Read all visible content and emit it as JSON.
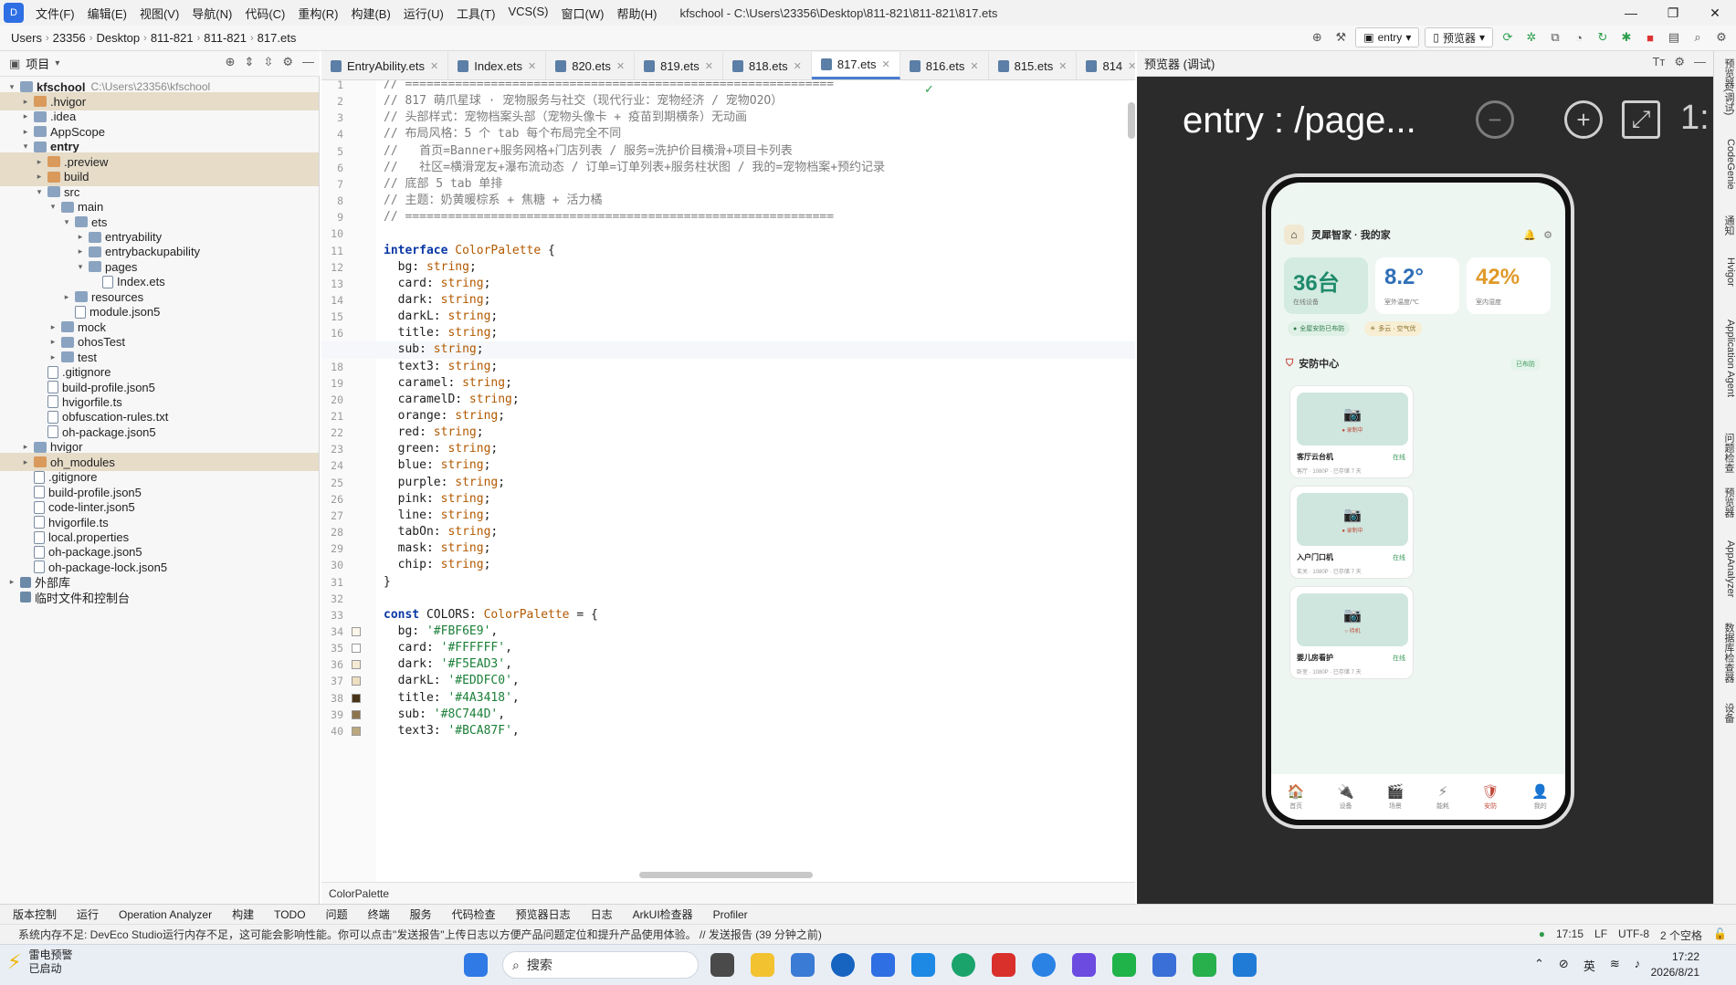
{
  "menubar": {
    "items": [
      "文件(F)",
      "编辑(E)",
      "视图(V)",
      "导航(N)",
      "代码(C)",
      "重构(R)",
      "构建(B)",
      "运行(U)",
      "工具(T)",
      "VCS(S)",
      "窗口(W)",
      "帮助(H)"
    ],
    "title": "kfschool - C:\\Users\\23356\\Desktop\\811-821\\811-821\\817.ets"
  },
  "navbar": {
    "crumbs": [
      "Users",
      "23356",
      "Desktop",
      "811-821",
      "811-821",
      "817.ets"
    ],
    "run_config": "entry",
    "device": "预览器"
  },
  "project": {
    "header": "项目",
    "tree": [
      {
        "label": "kfschool",
        "dim": "C:\\Users\\23356\\kfschool",
        "depth": 0,
        "arrow": "▾",
        "kind": "folder",
        "bold": true
      },
      {
        "label": ".hvigor",
        "depth": 1,
        "arrow": "▸",
        "kind": "ofolder",
        "sel": true
      },
      {
        "label": ".idea",
        "depth": 1,
        "arrow": "▸",
        "kind": "folder"
      },
      {
        "label": "AppScope",
        "depth": 1,
        "arrow": "▸",
        "kind": "folder"
      },
      {
        "label": "entry",
        "depth": 1,
        "arrow": "▾",
        "kind": "folder",
        "bold": true
      },
      {
        "label": ".preview",
        "depth": 2,
        "arrow": "▸",
        "kind": "ofolder",
        "sel": true
      },
      {
        "label": "build",
        "depth": 2,
        "arrow": "▸",
        "kind": "ofolder",
        "sel": true
      },
      {
        "label": "src",
        "depth": 2,
        "arrow": "▾",
        "kind": "folder"
      },
      {
        "label": "main",
        "depth": 3,
        "arrow": "▾",
        "kind": "folder"
      },
      {
        "label": "ets",
        "depth": 4,
        "arrow": "▾",
        "kind": "folder"
      },
      {
        "label": "entryability",
        "depth": 5,
        "arrow": "▸",
        "kind": "folder"
      },
      {
        "label": "entrybackupability",
        "depth": 5,
        "arrow": "▸",
        "kind": "folder"
      },
      {
        "label": "pages",
        "depth": 5,
        "arrow": "▾",
        "kind": "folder"
      },
      {
        "label": "Index.ets",
        "depth": 6,
        "arrow": "",
        "kind": "file"
      },
      {
        "label": "resources",
        "depth": 4,
        "arrow": "▸",
        "kind": "folder"
      },
      {
        "label": "module.json5",
        "depth": 4,
        "arrow": "",
        "kind": "file"
      },
      {
        "label": "mock",
        "depth": 3,
        "arrow": "▸",
        "kind": "folder"
      },
      {
        "label": "ohosTest",
        "depth": 3,
        "arrow": "▸",
        "kind": "folder"
      },
      {
        "label": "test",
        "depth": 3,
        "arrow": "▸",
        "kind": "folder"
      },
      {
        "label": ".gitignore",
        "depth": 2,
        "arrow": "",
        "kind": "file"
      },
      {
        "label": "build-profile.json5",
        "depth": 2,
        "arrow": "",
        "kind": "file"
      },
      {
        "label": "hvigorfile.ts",
        "depth": 2,
        "arrow": "",
        "kind": "file"
      },
      {
        "label": "obfuscation-rules.txt",
        "depth": 2,
        "arrow": "",
        "kind": "file"
      },
      {
        "label": "oh-package.json5",
        "depth": 2,
        "arrow": "",
        "kind": "file"
      },
      {
        "label": "hvigor",
        "depth": 1,
        "arrow": "▸",
        "kind": "folder"
      },
      {
        "label": "oh_modules",
        "depth": 1,
        "arrow": "▸",
        "kind": "ofolder",
        "sel": true
      },
      {
        "label": ".gitignore",
        "depth": 1,
        "arrow": "",
        "kind": "file"
      },
      {
        "label": "build-profile.json5",
        "depth": 1,
        "arrow": "",
        "kind": "file"
      },
      {
        "label": "code-linter.json5",
        "depth": 1,
        "arrow": "",
        "kind": "file"
      },
      {
        "label": "hvigorfile.ts",
        "depth": 1,
        "arrow": "",
        "kind": "file"
      },
      {
        "label": "local.properties",
        "depth": 1,
        "arrow": "",
        "kind": "file"
      },
      {
        "label": "oh-package.json5",
        "depth": 1,
        "arrow": "",
        "kind": "file"
      },
      {
        "label": "oh-package-lock.json5",
        "depth": 1,
        "arrow": "",
        "kind": "file"
      },
      {
        "label": "外部库",
        "depth": 0,
        "arrow": "▸",
        "kind": "lib"
      },
      {
        "label": "临时文件和控制台",
        "depth": 0,
        "arrow": "",
        "kind": "lib"
      }
    ]
  },
  "tabs": [
    {
      "label": "EntryAbility.ets",
      "active": false
    },
    {
      "label": "Index.ets",
      "active": false
    },
    {
      "label": "820.ets",
      "active": false
    },
    {
      "label": "819.ets",
      "active": false
    },
    {
      "label": "818.ets",
      "active": false
    },
    {
      "label": "817.ets",
      "active": true
    },
    {
      "label": "816.ets",
      "active": false
    },
    {
      "label": "815.ets",
      "active": false
    },
    {
      "label": "814",
      "active": false
    }
  ],
  "editor": {
    "current_line": 17,
    "lines": [
      [
        [
          "c-com",
          "// ============================================================"
        ]
      ],
      [
        [
          "c-com",
          "// 817 萌爪星球 · 宠物服务与社交（现代行业：宠物经济 / 宠物O2O）"
        ]
      ],
      [
        [
          "c-com",
          "// 头部样式：宠物档案头部（宠物头像卡 + 疫苗到期横条）无动画"
        ]
      ],
      [
        [
          "c-com",
          "// 布局风格：5 个 tab 每个布局完全不同"
        ]
      ],
      [
        [
          "c-com",
          "//   首页=Banner+服务网格+门店列表 / 服务=洗护价目横滑+项目卡列表"
        ]
      ],
      [
        [
          "c-com",
          "//   社区=横滑宠友+瀑布流动态 / 订单=订单列表+服务柱状图 / 我的=宠物档案+预约记录"
        ]
      ],
      [
        [
          "c-com",
          "// 底部 5 tab 单排"
        ]
      ],
      [
        [
          "c-com",
          "// 主题：奶黄暖棕系 + 焦糖 + 活力橘"
        ]
      ],
      [
        [
          "c-com",
          "// ============================================================"
        ]
      ],
      [
        [
          "",
          ""
        ]
      ],
      [
        [
          "c-kw",
          "interface"
        ],
        [
          "",
          " "
        ],
        [
          "c-ty",
          "ColorPalette"
        ],
        [
          "",
          " {"
        ]
      ],
      [
        [
          "",
          "  bg: "
        ],
        [
          "c-ty",
          "string"
        ],
        [
          "",
          ";"
        ]
      ],
      [
        [
          "",
          "  card: "
        ],
        [
          "c-ty",
          "string"
        ],
        [
          "",
          ";"
        ]
      ],
      [
        [
          "",
          "  dark: "
        ],
        [
          "c-ty",
          "string"
        ],
        [
          "",
          ";"
        ]
      ],
      [
        [
          "",
          "  darkL: "
        ],
        [
          "c-ty",
          "string"
        ],
        [
          "",
          ";"
        ]
      ],
      [
        [
          "",
          "  title: "
        ],
        [
          "c-ty",
          "string"
        ],
        [
          "",
          ";"
        ]
      ],
      [
        [
          "",
          "  sub: "
        ],
        [
          "c-ty",
          "string"
        ],
        [
          "",
          ";"
        ]
      ],
      [
        [
          "",
          "  text3: "
        ],
        [
          "c-ty",
          "string"
        ],
        [
          "",
          ";"
        ]
      ],
      [
        [
          "",
          "  caramel: "
        ],
        [
          "c-ty",
          "string"
        ],
        [
          "",
          ";"
        ]
      ],
      [
        [
          "",
          "  caramelD: "
        ],
        [
          "c-ty",
          "string"
        ],
        [
          "",
          ";"
        ]
      ],
      [
        [
          "",
          "  orange: "
        ],
        [
          "c-ty",
          "string"
        ],
        [
          "",
          ";"
        ]
      ],
      [
        [
          "",
          "  red: "
        ],
        [
          "c-ty",
          "string"
        ],
        [
          "",
          ";"
        ]
      ],
      [
        [
          "",
          "  green: "
        ],
        [
          "c-ty",
          "string"
        ],
        [
          "",
          ";"
        ]
      ],
      [
        [
          "",
          "  blue: "
        ],
        [
          "c-ty",
          "string"
        ],
        [
          "",
          ";"
        ]
      ],
      [
        [
          "",
          "  purple: "
        ],
        [
          "c-ty",
          "string"
        ],
        [
          "",
          ";"
        ]
      ],
      [
        [
          "",
          "  pink: "
        ],
        [
          "c-ty",
          "string"
        ],
        [
          "",
          ";"
        ]
      ],
      [
        [
          "",
          "  line: "
        ],
        [
          "c-ty",
          "string"
        ],
        [
          "",
          ";"
        ]
      ],
      [
        [
          "",
          "  tabOn: "
        ],
        [
          "c-ty",
          "string"
        ],
        [
          "",
          ";"
        ]
      ],
      [
        [
          "",
          "  mask: "
        ],
        [
          "c-ty",
          "string"
        ],
        [
          "",
          ";"
        ]
      ],
      [
        [
          "",
          "  chip: "
        ],
        [
          "c-ty",
          "string"
        ],
        [
          "",
          ";"
        ]
      ],
      [
        [
          "",
          "}"
        ]
      ],
      [
        [
          "",
          ""
        ]
      ],
      [
        [
          "c-kw",
          "const"
        ],
        [
          "",
          " COLORS: "
        ],
        [
          "c-ty",
          "ColorPalette"
        ],
        [
          "",
          " = {"
        ]
      ],
      [
        [
          "",
          "  bg: "
        ],
        [
          "c-str",
          "'#FBF6E9'"
        ],
        [
          "",
          ","
        ]
      ],
      [
        [
          "",
          "  card: "
        ],
        [
          "c-str",
          "'#FFFFFF'"
        ],
        [
          "",
          ","
        ]
      ],
      [
        [
          "",
          "  dark: "
        ],
        [
          "c-str",
          "'#F5EAD3'"
        ],
        [
          "",
          ","
        ]
      ],
      [
        [
          "",
          "  darkL: "
        ],
        [
          "c-str",
          "'#EDDFC0'"
        ],
        [
          "",
          ","
        ]
      ],
      [
        [
          "",
          "  title: "
        ],
        [
          "c-str",
          "'#4A3418'"
        ],
        [
          "",
          ","
        ]
      ],
      [
        [
          "",
          "  sub: "
        ],
        [
          "c-str",
          "'#8C744D'"
        ],
        [
          "",
          ","
        ]
      ],
      [
        [
          "",
          "  text3: "
        ],
        [
          "c-str",
          "'#BCA87F'"
        ],
        [
          "",
          ","
        ]
      ]
    ],
    "swatches": {
      "34": "#FBF6E9",
      "35": "#FFFFFF",
      "36": "#F5EAD3",
      "37": "#EDDFC0",
      "38": "#4A3418",
      "39": "#8C744D",
      "40": "#BCA87F"
    },
    "breadcrumb": "ColorPalette"
  },
  "preview": {
    "header": "预览器 (调试)",
    "title": "entry : /page...",
    "zoom_text": "1:",
    "app": {
      "home_name": "灵犀智家 · 我的家",
      "stats": [
        {
          "value": "36台",
          "label": "在线设备",
          "color": "#1f8a6a"
        },
        {
          "value": "8.2°",
          "label": "室外温度/℃",
          "color": "#2f6fb8"
        },
        {
          "value": "42%",
          "label": "室内湿度",
          "color": "#e09a2a"
        }
      ],
      "chips": [
        "全屋安防已布防",
        "多云 · 空气优"
      ],
      "section": "安防中心",
      "section_badge": "已布防",
      "cams": [
        {
          "name": "客厅云台机",
          "status": "在线",
          "desc": "客厅 · 1080P · 已存储 7 天",
          "tag": "● 录制中"
        },
        {
          "name": "入户门口机",
          "status": "在线",
          "desc": "玄关 · 1080P · 已存储 7 天",
          "tag": "● 录制中"
        },
        {
          "name": "婴儿房看护",
          "status": "在线",
          "desc": "卧室 · 1080P · 已存储 7 天",
          "tag": "○ 待机"
        }
      ],
      "nav": [
        {
          "icon": "🏠",
          "label": "首页",
          "on": false
        },
        {
          "icon": "🔌",
          "label": "设备",
          "on": false
        },
        {
          "icon": "🎬",
          "label": "场景",
          "on": false
        },
        {
          "icon": "⚡",
          "label": "能耗",
          "on": false
        },
        {
          "icon": "🛡",
          "label": "安防",
          "on": true
        },
        {
          "icon": "👤",
          "label": "我的",
          "on": false
        }
      ]
    }
  },
  "rightstrip": [
    "预览器(调试)",
    "CodeGenie",
    "通知",
    "Hvigor",
    "Application Agent",
    "问题检查",
    "预览器",
    "AppAnalyzer",
    "数据库检查器",
    "设备"
  ],
  "toolwindows": [
    "版本控制",
    "运行",
    "Operation Analyzer",
    "构建",
    "TODO",
    "问题",
    "终端",
    "服务",
    "代码检查",
    "预览器日志",
    "日志",
    "ArkUI检查器",
    "Profiler"
  ],
  "status": {
    "message": "系统内存不足: DevEco Studio运行内存不足，这可能会影响性能。你可以点击\"发送报告\"上传日志以方便产品问题定位和提升产品使用体验。 // 发送报告 (39 分钟之前)",
    "pos": "17:15",
    "eol": "LF",
    "enc": "UTF-8",
    "indent": "2 个空格"
  },
  "taskbar": {
    "weather_title": "雷电预警",
    "weather_sub": "已启动",
    "search": "搜索",
    "ime": "英",
    "time": "17:22",
    "date": "2026/8/21"
  }
}
